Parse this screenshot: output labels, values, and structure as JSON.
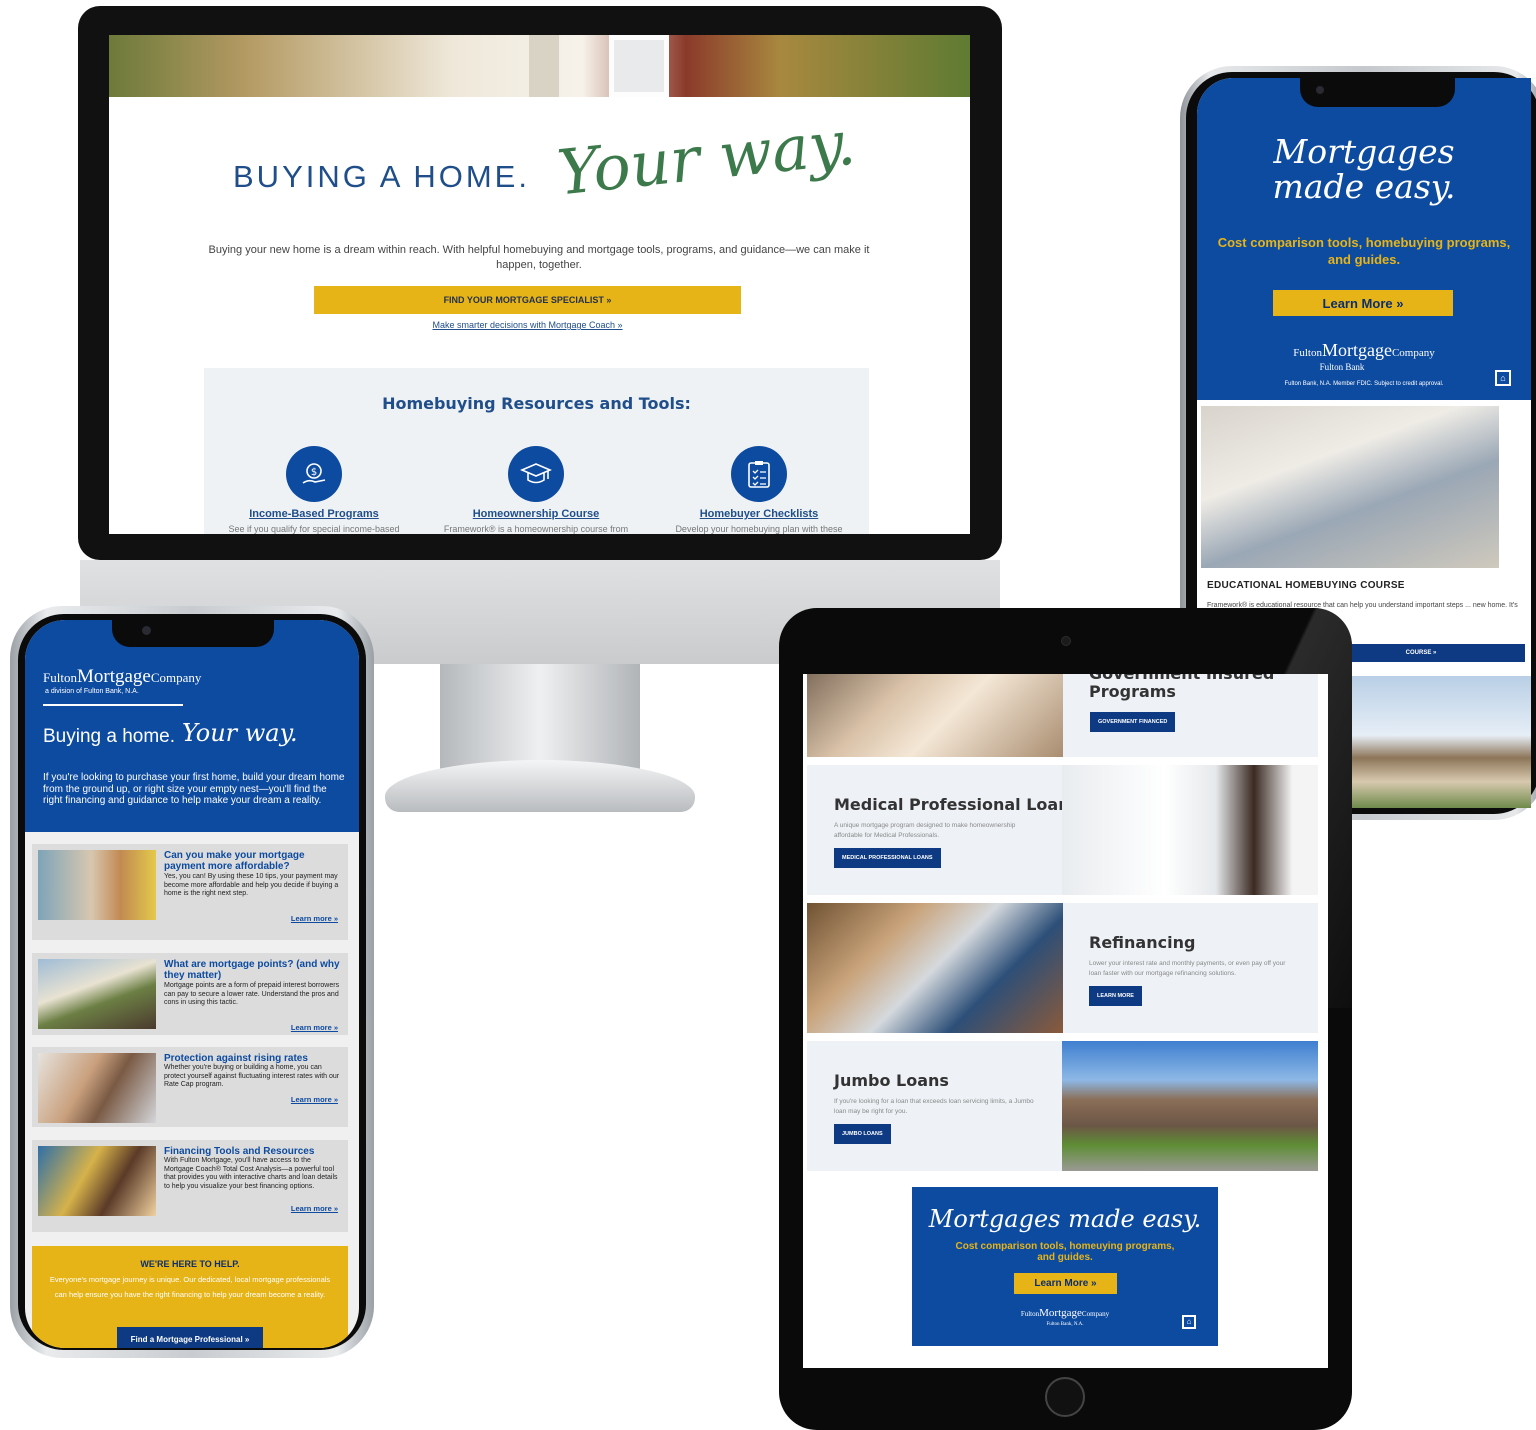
{
  "colors": {
    "brand_blue": "#0d4ba0",
    "accent_gold": "#e7b417",
    "script_green": "#3c7a4b",
    "navy": "#0d3a82"
  },
  "desktop": {
    "title_plain": "BUYING A HOME.",
    "title_script": "Your way.",
    "intro": "Buying your new home is a dream within reach. With helpful homebuying and mortgage tools, programs, and guidance—we can make it happen, together.",
    "cta": "FIND YOUR MORTGAGE SPECIALIST »",
    "link": "Make smarter decisions with Mortgage Coach »",
    "resources_title": "Homebuying Resources and Tools:",
    "tools": [
      {
        "label": "Income-Based Programs",
        "desc": "See if you qualify for special income-based",
        "icon": "money-hand-icon"
      },
      {
        "label": "Homeownership Course",
        "desc": "Framework® is a homeownership course from",
        "icon": "graduation-cap-icon"
      },
      {
        "label": "Homebuyer Checklists",
        "desc": "Develop your homebuying plan with these",
        "icon": "clipboard-checklist-icon"
      }
    ]
  },
  "left_phone": {
    "logo_prefix": "Fulton",
    "logo_main": "Mortgage",
    "logo_suffix": "Company",
    "logo_sub": "a division of Fulton Bank, N.A.",
    "headline": "Buying a home.",
    "headline_script": "Your way.",
    "intro": "If you're looking to purchase your first home, build your dream home from the ground up, or right size your empty nest—you'll find the right financing and guidance to help make your dream a reality.",
    "cards": [
      {
        "title": "Can you make your mortgage payment more affordable?",
        "text": "Yes, you can! By using these 10 tips, your payment may become more affordable and help you decide if buying a home is the right next step.",
        "more": "Learn more »"
      },
      {
        "title": "What are mortgage points? (and why they matter)",
        "text": "Mortgage points are a form of prepaid interest borrowers can pay to secure a lower rate. Understand the pros and cons in using this tactic.",
        "more": "Learn more »"
      },
      {
        "title": "Protection against rising rates",
        "text": "Whether you're buying or building a home, you can protect yourself against fluctuating interest rates with our Rate Cap program.",
        "more": "Learn more »"
      },
      {
        "title": "Financing Tools and Resources",
        "text": "With Fulton Mortgage, you'll have access to the Mortgage Coach® Total Cost Analysis—a powerful tool that provides you with interactive charts and loan details to help you visualize your best financing options.",
        "more": "Learn more »"
      }
    ],
    "help_title": "WE'RE HERE TO HELP.",
    "help_text": "Everyone's mortgage journey is unique. Our dedicated, local mortgage professionals can help ensure you have the right financing to help your dream become a reality.",
    "help_button": "Find a Mortgage Professional »"
  },
  "right_phone": {
    "script_line1": "Mortgages",
    "script_line2": "made easy.",
    "sub": "Cost comparison tools, homebuying programs, and guides.",
    "button": "Learn More »",
    "logo_prefix": "Fulton",
    "logo_main": "Mortgage",
    "logo_suffix": "Company",
    "logo_sub": "Fulton Bank",
    "legal": "Fulton Bank, N.A. Member FDIC. Subject to credit approval.",
    "course_title": "EDUCATIONAL HOMEBUYING COURSE",
    "course_text": "Framework® is educational resource that can help you understand important steps ... new home. It's accepted by most first-time ... cation.",
    "course_button": "COURSE »"
  },
  "tablet": {
    "rows": [
      {
        "title": "Government Insured Programs",
        "text": "",
        "button": "GOVERNMENT FINANCED"
      },
      {
        "title": "Medical Professional Loans",
        "text": "A unique mortgage program designed to make homeownership affordable for Medical Professionals.",
        "button": "MEDICAL PROFESSIONAL LOANS"
      },
      {
        "title": "Refinancing",
        "text": "Lower your interest rate and monthly payments, or even pay off your loan faster with our mortgage refinancing solutions.",
        "button": "LEARN MORE"
      },
      {
        "title": "Jumbo Loans",
        "text": "If you're looking for a loan that exceeds loan servicing limits, a Jumbo loan may be right for you.",
        "button": "JUMBO LOANS"
      }
    ],
    "promo_script": "Mortgages made easy.",
    "promo_sub": "Cost comparison tools, homeuying programs, and guides.",
    "promo_button": "Learn More »",
    "promo_logo_prefix": "Fulton",
    "promo_logo_main": "Mortgage",
    "promo_logo_suffix": "Company",
    "promo_logo_sub": "Fulton Bank, N.A."
  }
}
